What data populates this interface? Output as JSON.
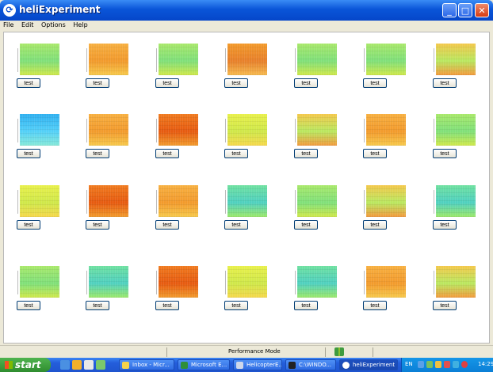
{
  "window": {
    "title": "heliExperiment"
  },
  "menu": [
    "File",
    "Edit",
    "Options",
    "Help"
  ],
  "grid": {
    "button_label": "test",
    "rows": 4,
    "cols": 7,
    "cells": [
      {
        "palette": "green"
      },
      {
        "palette": "orange"
      },
      {
        "palette": "green"
      },
      {
        "palette": "orange-dark"
      },
      {
        "palette": "green"
      },
      {
        "palette": "green"
      },
      {
        "palette": "mixed"
      },
      {
        "palette": "blue"
      },
      {
        "palette": "orange"
      },
      {
        "palette": "red"
      },
      {
        "palette": "yellow"
      },
      {
        "palette": "mixed"
      },
      {
        "palette": "orange"
      },
      {
        "palette": "green"
      },
      {
        "palette": "yellow"
      },
      {
        "palette": "red"
      },
      {
        "palette": "orange"
      },
      {
        "palette": "cyan"
      },
      {
        "palette": "green"
      },
      {
        "palette": "mixed"
      },
      {
        "palette": "cyan"
      },
      {
        "palette": "green"
      },
      {
        "palette": "cyan"
      },
      {
        "palette": "red"
      },
      {
        "palette": "yellow"
      },
      {
        "palette": "cyan"
      },
      {
        "palette": "orange"
      },
      {
        "palette": "mixed"
      }
    ]
  },
  "status": {
    "text": "Performance Mode"
  },
  "taskbar": {
    "start_label": "start",
    "tasks": [
      {
        "label": "Inbox - Micr..."
      },
      {
        "label": "Microsoft E..."
      },
      {
        "label": "HelicopterE..."
      },
      {
        "label": "C:\\WINDO..."
      },
      {
        "label": "heliExperiment"
      }
    ],
    "language": "EN",
    "clock": "14:29"
  },
  "colors": {
    "green": [
      "#a8e86a",
      "#7fe07a",
      "#cfe84a"
    ],
    "orange": [
      "#f7b040",
      "#f29a2c",
      "#f6c84a"
    ],
    "orange-dark": [
      "#f39a2a",
      "#e8802a",
      "#f5b94e"
    ],
    "red": [
      "#f07a1e",
      "#e65a10",
      "#f19a2c"
    ],
    "yellow": [
      "#e8f04a",
      "#cfe84a",
      "#f5d84a"
    ],
    "cyan": [
      "#6ee0a0",
      "#4fd0c0",
      "#9be86a"
    ],
    "blue": [
      "#2fb0f0",
      "#54d0f8",
      "#86e8d8"
    ],
    "mixed": [
      "#f3c84a",
      "#b9e860",
      "#f29a3c"
    ]
  }
}
